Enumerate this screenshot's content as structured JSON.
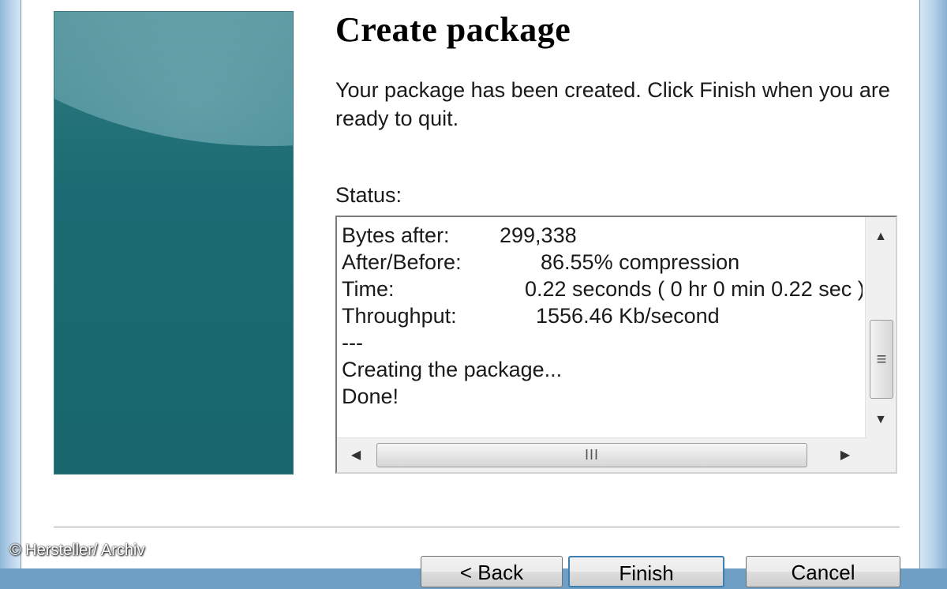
{
  "dialog": {
    "title": "Create package",
    "description": "Your package has been created.  Click Finish when you are ready to quit."
  },
  "status": {
    "label": "Status:",
    "lines": {
      "bytes_after": {
        "key": "Bytes after:",
        "value": "299,338"
      },
      "ratio": {
        "key": "After/Before:",
        "value": "86.55% compression"
      },
      "time": {
        "key": "Time:",
        "value": "0.22 seconds ( 0 hr  0 min  0.22 sec )"
      },
      "throughput": {
        "key": "Throughput:",
        "value": "1556.46 Kb/second"
      },
      "separator": "---",
      "creating": "Creating the package...",
      "done": "Done!"
    }
  },
  "scrollbars": {
    "vertical": {
      "up": "▲",
      "down": "▼",
      "thumb_grip": "≡"
    },
    "horizontal": {
      "left": "◀",
      "right": "▶",
      "thumb_grip": "III"
    }
  },
  "buttons": {
    "back": "< Back",
    "finish": "Finish",
    "cancel": "Cancel"
  },
  "watermark": "© Hersteller/ Archiv"
}
